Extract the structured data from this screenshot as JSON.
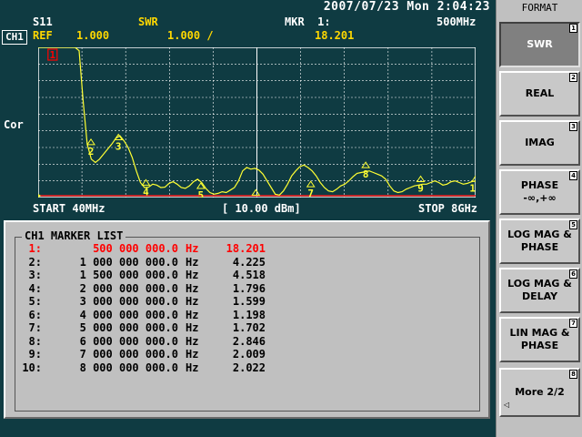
{
  "status": {
    "datetime": "2007/07/23 Mon  2:04:23"
  },
  "header": {
    "channel": "CH1",
    "param": "S11",
    "format": "SWR",
    "marker_label": "MKR  1:",
    "marker_freq": "500MHz",
    "ref_label": "REF",
    "ref_value": "1.000",
    "scale": "1.000 /",
    "marker_value": "18.201"
  },
  "graph": {
    "cal_label": "Cor",
    "start": "START 40MHz",
    "power": "[ 10.00 dBm]",
    "stop": "STOP 8GHz"
  },
  "chart_data": {
    "type": "line",
    "series": [
      {
        "values": [
          10.0,
          10.0,
          10.0,
          10.0,
          10.0,
          10.0,
          10.0,
          10.0,
          10.0,
          10.0,
          9.8,
          6.8,
          4.2,
          3.3,
          3.1,
          3.3,
          3.6,
          3.9,
          4.2,
          4.55,
          4.7,
          4.4,
          4.0,
          3.4,
          2.6,
          1.9,
          1.6,
          1.62,
          1.8,
          1.75,
          1.6,
          1.62,
          1.85,
          1.95,
          1.8,
          1.6,
          1.55,
          1.7,
          1.95,
          2.1,
          1.9,
          1.55,
          1.3,
          1.2,
          1.25,
          1.35,
          1.3,
          1.45,
          1.6,
          2.0,
          2.6,
          2.8,
          2.7,
          2.75,
          2.65,
          2.4,
          2.0,
          1.6,
          1.2,
          1.15,
          1.4,
          1.8,
          2.3,
          2.6,
          2.85,
          2.95,
          2.8,
          2.6,
          2.3,
          1.9,
          1.6,
          1.4,
          1.35,
          1.5,
          1.7,
          1.8,
          2.0,
          2.25,
          2.45,
          2.5,
          2.55,
          2.6,
          2.5,
          2.4,
          2.3,
          2.1,
          1.7,
          1.4,
          1.3,
          1.35,
          1.5,
          1.6,
          1.7,
          1.75,
          1.8,
          1.8,
          1.9,
          2.0,
          1.9,
          1.75,
          1.8,
          1.95,
          2.0,
          1.9,
          1.8,
          1.85,
          1.95,
          2.0
        ]
      }
    ],
    "xlim": [
      0.04,
      8.0
    ],
    "ylim": [
      1.0,
      10.0
    ],
    "grid": true,
    "markers": [
      {
        "label": "1",
        "x": 0.5,
        "y": 18.201
      },
      {
        "label": "2",
        "x": 1.0,
        "y": 4.225
      },
      {
        "label": "3",
        "x": 1.5,
        "y": 4.518
      },
      {
        "label": "4",
        "x": 2.0,
        "y": 1.796
      },
      {
        "label": "5",
        "x": 3.0,
        "y": 1.599
      },
      {
        "label": "6",
        "x": 4.0,
        "y": 1.198
      },
      {
        "label": "7",
        "x": 5.0,
        "y": 1.702
      },
      {
        "label": "8",
        "x": 6.0,
        "y": 2.846
      },
      {
        "label": "9",
        "x": 7.0,
        "y": 2.009
      },
      {
        "label": "10",
        "x": 8.0,
        "y": 2.022
      }
    ]
  },
  "marker_list": {
    "title": "CH1 MARKER LIST",
    "rows": [
      {
        "num": "1:",
        "freq": "500 000 000.0",
        "unit": "Hz",
        "value": "18.201",
        "active": true
      },
      {
        "num": "2:",
        "freq": "1 000 000 000.0",
        "unit": "Hz",
        "value": "4.225",
        "active": false
      },
      {
        "num": "3:",
        "freq": "1 500 000 000.0",
        "unit": "Hz",
        "value": "4.518",
        "active": false
      },
      {
        "num": "4:",
        "freq": "2 000 000 000.0",
        "unit": "Hz",
        "value": "1.796",
        "active": false
      },
      {
        "num": "5:",
        "freq": "3 000 000 000.0",
        "unit": "Hz",
        "value": "1.599",
        "active": false
      },
      {
        "num": "6:",
        "freq": "4 000 000 000.0",
        "unit": "Hz",
        "value": "1.198",
        "active": false
      },
      {
        "num": "7:",
        "freq": "5 000 000 000.0",
        "unit": "Hz",
        "value": "1.702",
        "active": false
      },
      {
        "num": "8:",
        "freq": "6 000 000 000.0",
        "unit": "Hz",
        "value": "2.846",
        "active": false
      },
      {
        "num": "9:",
        "freq": "7 000 000 000.0",
        "unit": "Hz",
        "value": "2.009",
        "active": false
      },
      {
        "num": "10:",
        "freq": "8 000 000 000.0",
        "unit": "Hz",
        "value": "2.022",
        "active": false
      }
    ]
  },
  "softkeys": {
    "title": "FORMAT",
    "keys": [
      {
        "line1": "SWR",
        "line2": "",
        "num": "1",
        "selected": true
      },
      {
        "line1": "REAL",
        "line2": "",
        "num": "2",
        "selected": false
      },
      {
        "line1": "IMAG",
        "line2": "",
        "num": "3",
        "selected": false
      },
      {
        "line1": "PHASE",
        "line2": "-∞,+∞",
        "num": "4",
        "selected": false
      },
      {
        "line1": "LOG MAG &",
        "line2": "PHASE",
        "num": "5",
        "selected": false
      },
      {
        "line1": "LOG MAG &",
        "line2": "DELAY",
        "num": "6",
        "selected": false
      },
      {
        "line1": "LIN MAG &",
        "line2": "PHASE",
        "num": "7",
        "selected": false
      },
      {
        "line1": "More 2/2",
        "line2": "",
        "num": "8",
        "selected": false
      }
    ]
  },
  "colors": {
    "background": "#0f3b42",
    "trace": "#ffff33",
    "grid": "#ffffff",
    "marker_active": "#ff0000",
    "ref_line": "#ff2020"
  }
}
